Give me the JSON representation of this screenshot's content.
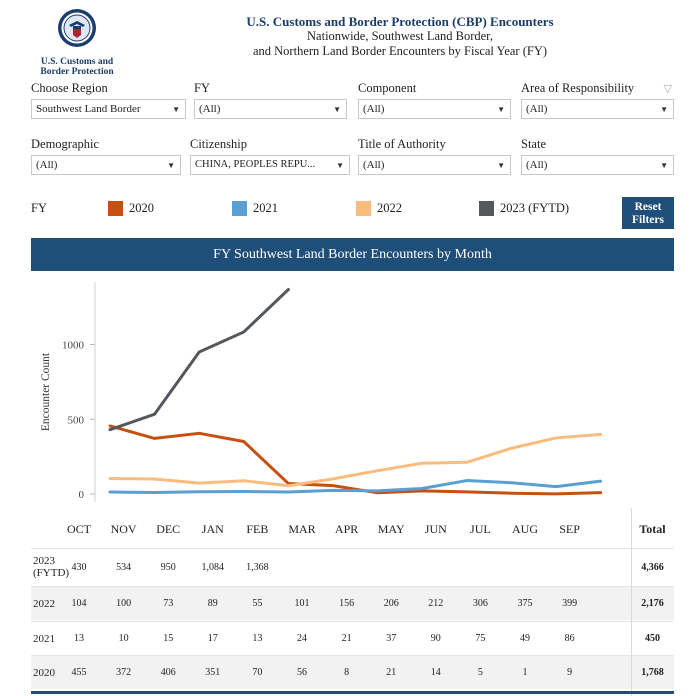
{
  "header": {
    "logo_line1": "U.S. Customs and",
    "logo_line2": "Border Protection",
    "title": "U.S. Customs and Border Protection (CBP) Encounters",
    "subtitle1": "Nationwide, Southwest Land Border,",
    "subtitle2": "and Northern Land Border Encounters by Fiscal Year (FY)"
  },
  "filters": {
    "region": {
      "label": "Choose Region",
      "value": "Southwest Land Border"
    },
    "fy": {
      "label": "FY",
      "value": "(All)"
    },
    "component": {
      "label": "Component",
      "value": "(All)"
    },
    "aor": {
      "label": "Area of Responsibility",
      "value": "(All)"
    },
    "demographic": {
      "label": "Demographic",
      "value": "(All)"
    },
    "citizenship": {
      "label": "Citizenship",
      "value": "CHINA, PEOPLES REPU..."
    },
    "authority": {
      "label": "Title of Authority",
      "value": "(All)"
    },
    "state": {
      "label": "State",
      "value": "(All)"
    }
  },
  "legend": {
    "label": "FY",
    "items": [
      {
        "name": "2020",
        "color": "#c5500f"
      },
      {
        "name": "2021",
        "color": "#5a9fd4"
      },
      {
        "name": "2022",
        "color": "#f9bc7e"
      },
      {
        "name": "2023 (FYTD)",
        "color": "#55575f"
      }
    ],
    "reset_line1": "Reset",
    "reset_line2": "Filters"
  },
  "chart_title": "FY Southwest Land Border Encounters by Month",
  "chart_data": {
    "type": "line",
    "ylabel": "Encounter Count",
    "xlabel": "",
    "ylim": [
      0,
      1400
    ],
    "yticks": [
      0,
      500,
      1000
    ],
    "categories": [
      "OCT",
      "NOV",
      "DEC",
      "JAN",
      "FEB",
      "MAR",
      "APR",
      "MAY",
      "JUN",
      "JUL",
      "AUG",
      "SEP"
    ],
    "series": [
      {
        "name": "2020",
        "color": "#c5500f",
        "values": [
          455,
          372,
          406,
          351,
          70,
          56,
          8,
          21,
          14,
          5,
          1,
          9
        ]
      },
      {
        "name": "2021",
        "color": "#5a9fd4",
        "values": [
          13,
          10,
          15,
          17,
          13,
          24,
          21,
          37,
          90,
          75,
          49,
          86
        ]
      },
      {
        "name": "2022",
        "color": "#f9bc7e",
        "values": [
          104,
          100,
          73,
          89,
          55,
          101,
          156,
          206,
          212,
          306,
          375,
          399
        ]
      },
      {
        "name": "2023 (FYTD)",
        "color": "#55575f",
        "values": [
          430,
          534,
          950,
          1084,
          1368
        ]
      }
    ]
  },
  "table": {
    "total_label": "Total",
    "rows": [
      {
        "label1": "2023",
        "label2": "(FYTD)",
        "cells": [
          "430",
          "534",
          "950",
          "1,084",
          "1,368",
          "",
          "",
          "",
          "",
          "",
          "",
          ""
        ],
        "total": "4,366"
      },
      {
        "label1": "2022",
        "label2": "",
        "cells": [
          "104",
          "100",
          "73",
          "89",
          "55",
          "101",
          "156",
          "206",
          "212",
          "306",
          "375",
          "399"
        ],
        "total": "2,176"
      },
      {
        "label1": "2021",
        "label2": "",
        "cells": [
          "13",
          "10",
          "15",
          "17",
          "13",
          "24",
          "21",
          "37",
          "90",
          "75",
          "49",
          "86"
        ],
        "total": "450"
      },
      {
        "label1": "2020",
        "label2": "",
        "cells": [
          "455",
          "372",
          "406",
          "351",
          "70",
          "56",
          "8",
          "21",
          "14",
          "5",
          "1",
          "9"
        ],
        "total": "1,768"
      }
    ]
  }
}
